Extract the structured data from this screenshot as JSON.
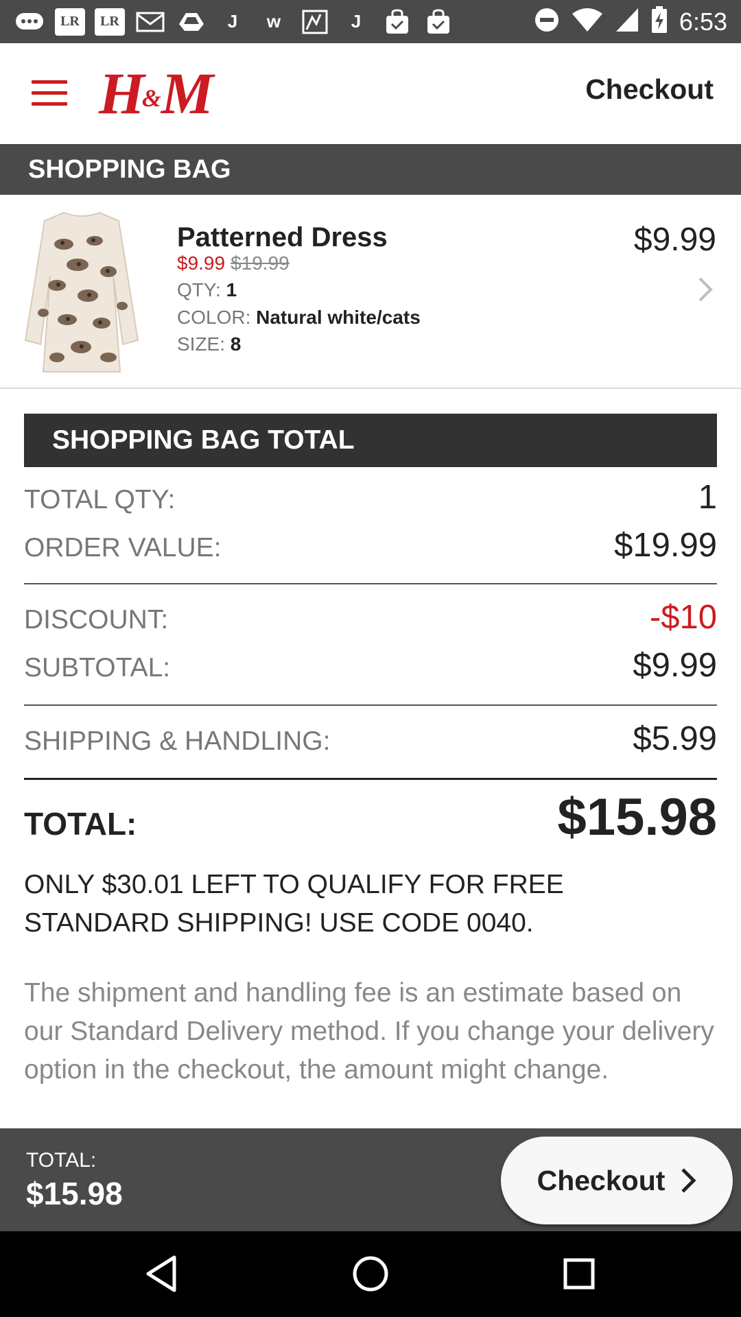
{
  "status_bar": {
    "time": "6:53",
    "left_icons": [
      "chat-bubble-icon",
      "lr-icon",
      "lr-icon",
      "mail-icon",
      "drive-icon",
      "j-icon",
      "w-icon",
      "map-icon",
      "j-icon",
      "shopping-bag-icon",
      "shopping-bag-check-icon"
    ],
    "lr_label": "LR",
    "right_icons": [
      "do-not-disturb-icon",
      "wifi-icon",
      "signal-icon",
      "battery-charging-icon"
    ]
  },
  "header": {
    "logo_text": "H",
    "logo_amp": "&",
    "logo_text_end": "M",
    "checkout_label": "Checkout"
  },
  "bag": {
    "section_title": "SHOPPING BAG",
    "items": [
      {
        "name": "Patterned Dress",
        "sale_price": "$9.99",
        "original_price": "$19.99",
        "qty_label": "QTY:",
        "qty": "1",
        "color_label": "COLOR:",
        "color": "Natural white/cats",
        "size_label": "SIZE:",
        "size": "8",
        "line_total": "$9.99"
      }
    ]
  },
  "summary": {
    "title": "SHOPPING BAG TOTAL",
    "total_qty_label": "TOTAL QTY:",
    "total_qty": "1",
    "order_value_label": "ORDER VALUE:",
    "order_value": "$19.99",
    "discount_label": "DISCOUNT:",
    "discount": "-$10",
    "subtotal_label": "SUBTOTAL:",
    "subtotal": "$9.99",
    "shipping_label": "SHIPPING & HANDLING:",
    "shipping": "$5.99",
    "total_label": "TOTAL:",
    "total": "$15.98",
    "promo": "ONLY $30.01 LEFT TO QUALIFY FOR FREE STANDARD SHIPPING! USE CODE 0040.",
    "note": "The shipment and handling fee is an estimate based on our Standard Delivery method. If you change your delivery option in the checkout, the amount might change."
  },
  "bottom_bar": {
    "total_label": "TOTAL:",
    "total": "$15.98",
    "checkout_label": "Checkout"
  },
  "colors": {
    "brand_red": "#cc1b22",
    "dark_bar": "#4a4a4a",
    "section_dark": "#323232"
  }
}
